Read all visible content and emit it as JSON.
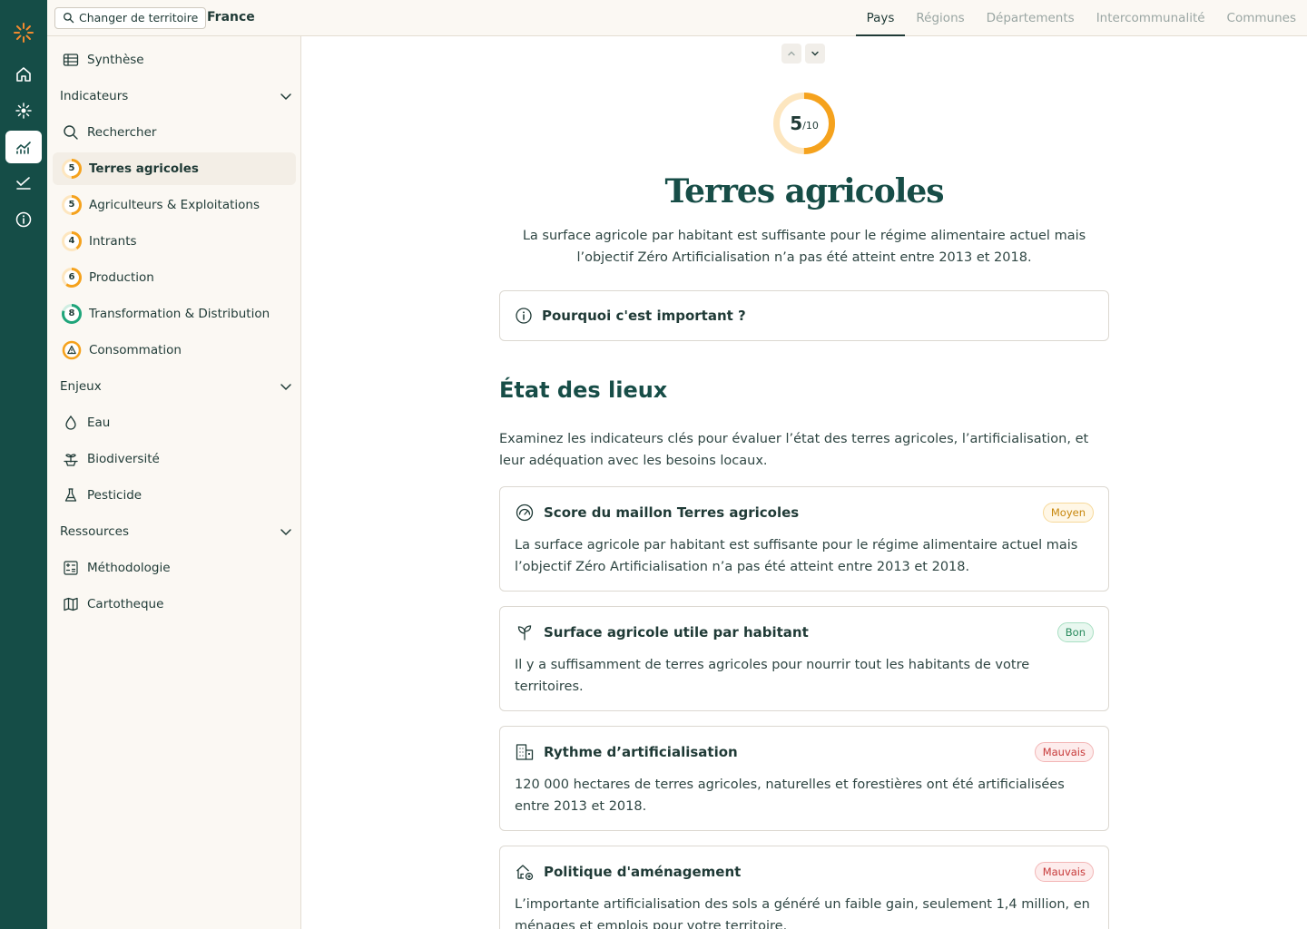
{
  "topbar": {
    "territory_button": "Changer de territoire",
    "territory_name": "France",
    "tabs": [
      "Pays",
      "Régions",
      "Départements",
      "Intercommunalité",
      "Communes"
    ]
  },
  "sidebar": {
    "synthese": "Synthèse",
    "indicateurs_header": "Indicateurs",
    "rechercher": "Rechercher",
    "indicators": [
      {
        "label": "Terres agricoles",
        "score": "5",
        "ratio": 0.5,
        "color": "#f5a21d"
      },
      {
        "label": "Agriculteurs & Exploitations",
        "score": "5",
        "ratio": 0.5,
        "color": "#f5a21d"
      },
      {
        "label": "Intrants",
        "score": "4",
        "ratio": 0.4,
        "color": "#f5a21d"
      },
      {
        "label": "Production",
        "score": "6",
        "ratio": 0.6,
        "color": "#f5a21d"
      },
      {
        "label": "Transformation & Distribution",
        "score": "8",
        "ratio": 0.8,
        "color": "#1fa57a"
      },
      {
        "label": "Consommation",
        "score": "",
        "ratio": 1.0,
        "color": "#f5a21d"
      }
    ],
    "enjeux_header": "Enjeux",
    "enjeux": [
      "Eau",
      "Biodiversité",
      "Pesticide"
    ],
    "ressources_header": "Ressources",
    "ressources": [
      "Méthodologie",
      "Cartotheque"
    ]
  },
  "main": {
    "score_value": "5",
    "score_total": "/10",
    "score_ratio": 0.5,
    "title": "Terres agricoles",
    "description": "La surface agricole par habitant est suffisante pour le régime alimentaire actuel mais l’objectif Zéro Artificialisation n’a pas été atteint entre 2013 et 2018.",
    "why_label": "Pourquoi c'est important ?",
    "section_title": "État des lieux",
    "section_description": "Examinez les indicateurs clés pour évaluer l’état des terres agricoles, l’artificialisation, et leur adéquation avec les besoins locaux.",
    "cards": [
      {
        "title": "Score du maillon Terres agricoles",
        "status": "Moyen",
        "body": "La surface agricole par habitant est suffisante pour le régime alimentaire actuel mais l’objectif Zéro Artificialisation n’a pas été atteint entre 2013 et 2018."
      },
      {
        "title": "Surface agricole utile par habitant",
        "status": "Bon",
        "body": "Il y a suffisamment de terres agricoles pour nourrir tout les habitants de votre territoires."
      },
      {
        "title": "Rythme d’artificialisation",
        "status": "Mauvais",
        "body": "120 000 hectares de terres agricoles, naturelles et forestières ont été artificialisées entre 2013 et 2018."
      },
      {
        "title": "Politique d'aménagement",
        "status": "Mauvais",
        "body": "L’importante artificialisation des sols a généré un faible gain, seulement 1,4 million, en ménages et emplois pour votre territoire."
      }
    ]
  },
  "colors": {
    "rail": "#154d47",
    "accent_orange": "#f5a21d",
    "accent_green": "#1fa57a",
    "title_green": "#174d47"
  }
}
